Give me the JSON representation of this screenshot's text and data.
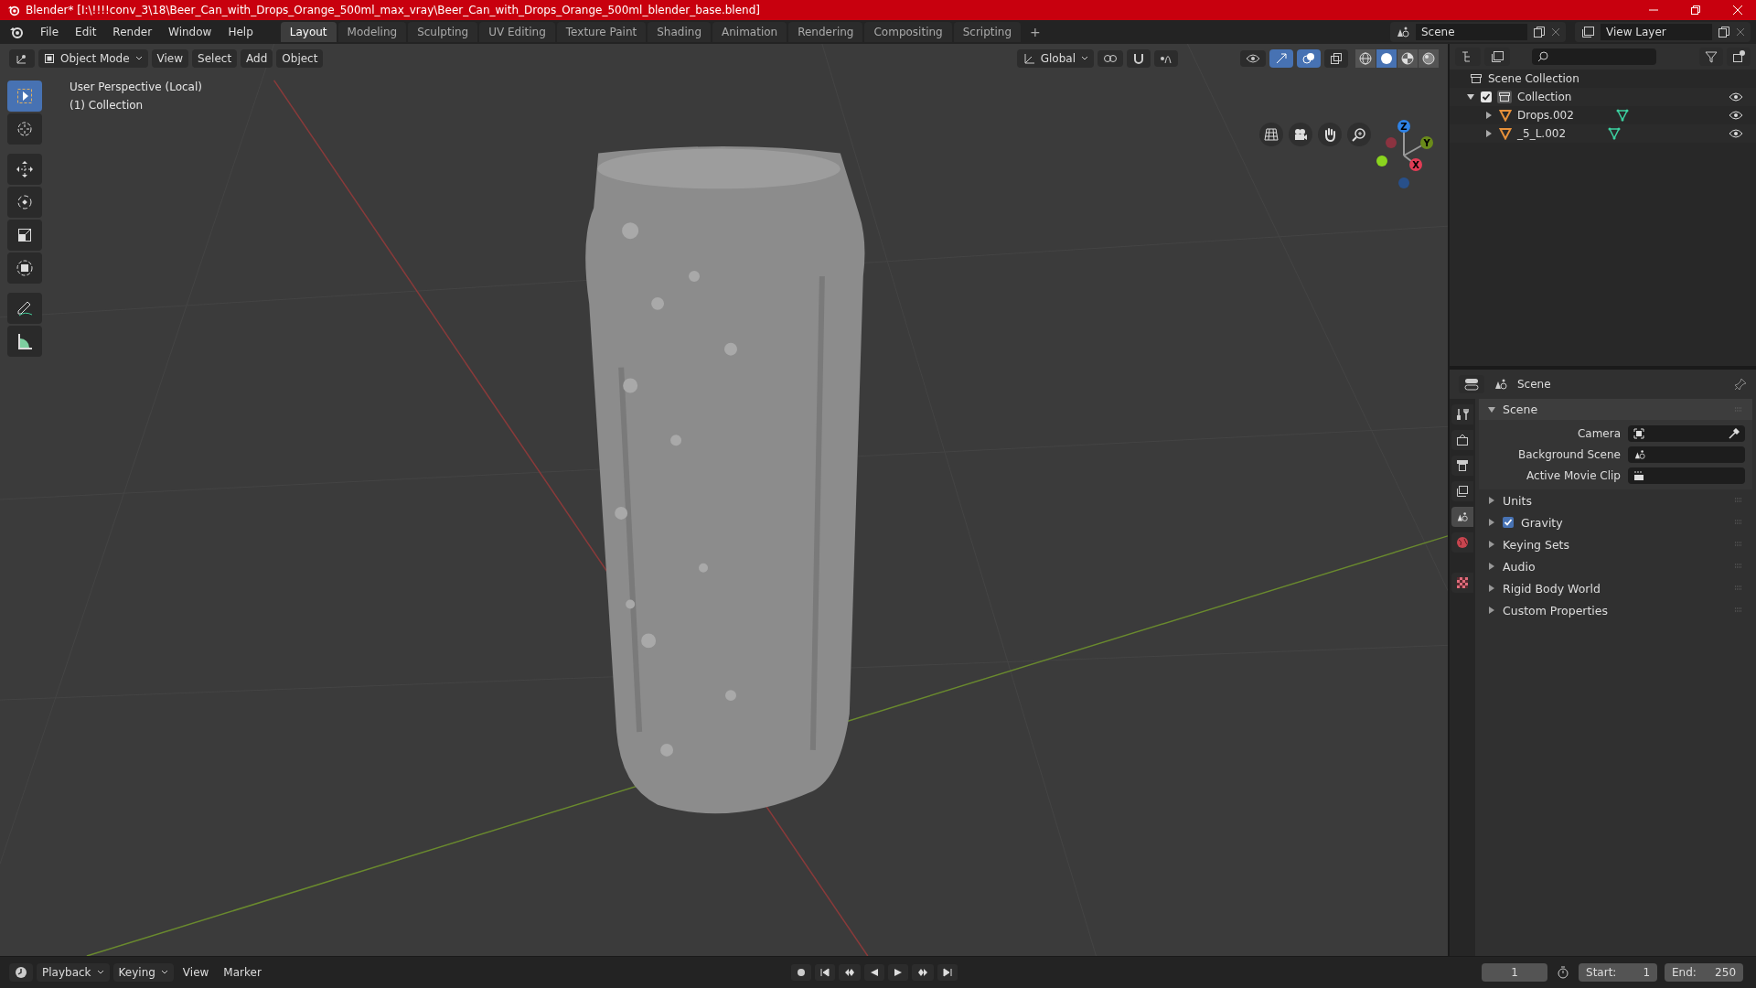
{
  "window": {
    "title": "Blender* [I:\\!!!!conv_3\\18\\Beer_Can_with_Drops_Orange_500ml_max_vray\\Beer_Can_with_Drops_Orange_500ml_blender_base.blend]"
  },
  "menus": [
    "File",
    "Edit",
    "Render",
    "Window",
    "Help"
  ],
  "workspaces": [
    {
      "label": "Layout",
      "selected": true
    },
    {
      "label": "Modeling",
      "selected": false
    },
    {
      "label": "Sculpting",
      "selected": false
    },
    {
      "label": "UV Editing",
      "selected": false
    },
    {
      "label": "Texture Paint",
      "selected": false
    },
    {
      "label": "Shading",
      "selected": false
    },
    {
      "label": "Animation",
      "selected": false
    },
    {
      "label": "Rendering",
      "selected": false
    },
    {
      "label": "Compositing",
      "selected": false
    },
    {
      "label": "Scripting",
      "selected": false
    }
  ],
  "add_workspace": "+",
  "scene_selector": {
    "value": "Scene"
  },
  "view_layer_selector": {
    "value": "View Layer"
  },
  "viewport": {
    "mode": "Object Mode",
    "menus": [
      "View",
      "Select",
      "Add",
      "Object"
    ],
    "orientation": "Global",
    "info": [
      "User Perspective (Local)",
      "(1) Collection"
    ],
    "tools": [
      {
        "kind": "select",
        "selected": true
      },
      {
        "kind": "cursor",
        "selected": false
      },
      {
        "kind": "move",
        "selected": false
      },
      {
        "kind": "rotate",
        "selected": false
      },
      {
        "kind": "scale",
        "selected": false
      },
      {
        "kind": "transform",
        "selected": false
      },
      {
        "kind": "annotate",
        "selected": false
      },
      {
        "kind": "measure",
        "selected": false
      }
    ],
    "shading": [
      {
        "kind": "wireframe",
        "selected": false
      },
      {
        "kind": "solid",
        "selected": true
      },
      {
        "kind": "material",
        "selected": false
      },
      {
        "kind": "rendered",
        "selected": false
      }
    ],
    "gizmo": {
      "x": "X",
      "y": "Y",
      "z": "Z"
    }
  },
  "outliner": {
    "root": "Scene Collection",
    "items": [
      {
        "label": "Collection",
        "checked": true,
        "expanded": true,
        "children": [
          {
            "label": "Drops.002",
            "expanded": false
          },
          {
            "label": "_5_L.002",
            "expanded": false
          }
        ]
      }
    ]
  },
  "properties": {
    "context": "Scene",
    "tabs": [
      {
        "kind": "tool",
        "selected": false
      },
      {
        "kind": "render",
        "selected": false
      },
      {
        "kind": "output",
        "selected": false
      },
      {
        "kind": "view_layer",
        "selected": false
      },
      {
        "kind": "scene",
        "selected": true
      },
      {
        "kind": "world",
        "selected": false
      },
      {
        "kind": "texture",
        "selected": false
      }
    ],
    "panel": {
      "title": "Scene",
      "expanded": true,
      "fields": [
        {
          "label": "Camera",
          "kind": "camera"
        },
        {
          "label": "Background Scene",
          "kind": "scene"
        },
        {
          "label": "Active Movie Clip",
          "kind": "clip"
        }
      ]
    },
    "subpanels": [
      {
        "title": "Units",
        "expanded": false
      },
      {
        "title": "Gravity",
        "expanded": false,
        "checked": true
      },
      {
        "title": "Keying Sets",
        "expanded": false
      },
      {
        "title": "Audio",
        "expanded": false
      },
      {
        "title": "Rigid Body World",
        "expanded": false
      },
      {
        "title": "Custom Properties",
        "expanded": false
      }
    ]
  },
  "timeline": {
    "menus": [
      "Playback",
      "Keying"
    ],
    "plain_menus": [
      "View",
      "Marker"
    ],
    "current_frame": "1",
    "start_label": "Start:",
    "start": "1",
    "end_label": "End:",
    "end": "250"
  }
}
